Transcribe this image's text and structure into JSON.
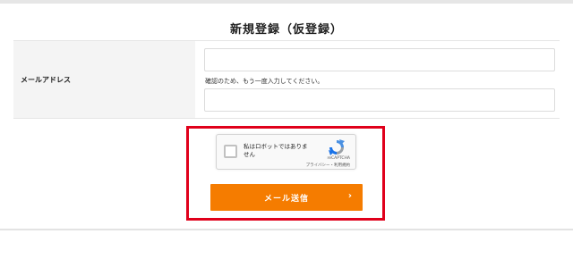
{
  "page": {
    "title": "新規登録（仮登録）"
  },
  "form": {
    "email_label": "メールアドレス",
    "email_value": "",
    "email_confirm_hint": "確認のため、もう一度入力してください。",
    "email_confirm_value": ""
  },
  "recaptcha": {
    "checkbox_label": "私はロボットではありません",
    "brand": "reCAPTCHA",
    "links": "プライバシー・利用規約",
    "checked": false
  },
  "submit": {
    "label": "メール送信",
    "arrow": "›"
  },
  "colors": {
    "accent": "#f57c00",
    "highlight": "#e0001b"
  }
}
